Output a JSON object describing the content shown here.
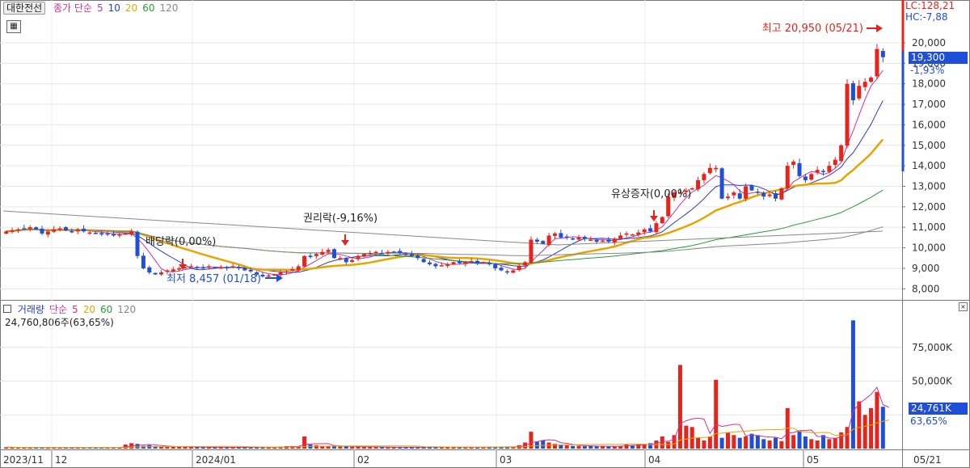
{
  "header": {
    "stock_name": "대한전선",
    "price_legend": [
      {
        "label": "종가 단순",
        "color": "#cc3399"
      },
      {
        "label": "5",
        "color": "#cc3399"
      },
      {
        "label": "10",
        "color": "#2a3fbf"
      },
      {
        "label": "20",
        "color": "#e6a500"
      },
      {
        "label": "60",
        "color": "#2a9a3a"
      },
      {
        "label": "120",
        "color": "#888888"
      }
    ],
    "volume_legend": [
      {
        "label": "거래량",
        "color": "#2a3fbf"
      },
      {
        "label": "단순",
        "color": "#cc3399"
      },
      {
        "label": "5",
        "color": "#cc3399"
      },
      {
        "label": "20",
        "color": "#e6a500"
      },
      {
        "label": "60",
        "color": "#2a9a3a"
      },
      {
        "label": "120",
        "color": "#888888"
      }
    ],
    "volume_value": "24,760,806주(63,65%)"
  },
  "right_panel": {
    "lc": "LC:128,21",
    "hc": "HC:-7,88",
    "price_tag": "19,300",
    "price_change": "-1,93%",
    "volume_tag": "24,761K",
    "volume_pct": "63,65%"
  },
  "colors": {
    "up": "#e8231b",
    "down": "#1f4fd8",
    "ma5": "#cc3399",
    "ma10": "#2a3fbf",
    "ma20": "#e6a500",
    "ma60": "#2a9a3a",
    "ma120": "#888888"
  },
  "chart_data": [
    {
      "type": "candlestick",
      "yticks": [
        8000,
        9000,
        10000,
        11000,
        12000,
        13000,
        14000,
        15000,
        16000,
        17000,
        18000,
        19000,
        20000
      ],
      "ytick_labels": [
        "8,000",
        "9,000",
        "10,000",
        "11,000",
        "12,000",
        "13,000",
        "14,000",
        "15,000",
        "16,000",
        "17,000",
        "18,000",
        "19,000",
        "20,000"
      ],
      "ylim": [
        7500,
        21300
      ],
      "x_labels": [
        "2023/11",
        "12",
        "2024/01",
        "02",
        "03",
        "04",
        "05",
        "05/21"
      ],
      "annotations": [
        {
          "text": "최고 20,950 (05/21)",
          "color": "#e8231b"
        },
        {
          "text": "최저 8,457 (01/18)",
          "color": "#1f4fd8"
        },
        {
          "text": "권리락(-9,16%)",
          "color": "#222222"
        },
        {
          "text": "배당락(0,00%)",
          "color": "#222222"
        },
        {
          "text": "유상증자(0,00%)",
          "color": "#222222"
        }
      ],
      "close": [
        10800,
        10850,
        10900,
        10950,
        11000,
        10900,
        10700,
        10800,
        10900,
        10950,
        10850,
        10800,
        10900,
        10800,
        10750,
        10700,
        10650,
        10700,
        10600,
        10650,
        10700,
        10800,
        9600,
        9000,
        8800,
        8700,
        8800,
        8900,
        8950,
        9000,
        9050,
        9100,
        9050,
        9000,
        9100,
        9050,
        9050,
        9000,
        9100,
        9000,
        8900,
        8850,
        8700,
        8600,
        8650,
        8700,
        8800,
        8850,
        8950,
        9100,
        9600,
        9550,
        9700,
        9800,
        9900,
        9500,
        9500,
        9300,
        9400,
        9600,
        9700,
        9750,
        9800,
        9750,
        9800,
        9800,
        9750,
        9700,
        9600,
        9500,
        9300,
        9200,
        9100,
        9150,
        9200,
        9300,
        9250,
        9300,
        9350,
        9250,
        9300,
        9200,
        9000,
        8900,
        8800,
        8900,
        9100,
        9300,
        10400,
        10300,
        10200,
        10600,
        10700,
        10500,
        10500,
        10400,
        10500,
        10450,
        10400,
        10300,
        10350,
        10300,
        10450,
        10600,
        10700,
        10650,
        10750,
        10900,
        10800,
        11200,
        11500,
        12500,
        12700,
        12700,
        12800,
        12900,
        13300,
        13600,
        13900,
        13900,
        12400,
        12500,
        12700,
        12400,
        13000,
        12800,
        12700,
        12500,
        12600,
        12400,
        12900,
        14000,
        14200,
        13500,
        13300,
        13600,
        13800,
        13700,
        14000,
        14300,
        15000,
        18000,
        17200,
        17900,
        18100,
        18300,
        19700,
        19300
      ],
      "volume_k": [
        1000,
        900,
        800,
        900,
        700,
        800,
        900,
        800,
        700,
        700,
        800,
        900,
        700,
        700,
        800,
        900,
        800,
        700,
        800,
        900,
        3000,
        4000,
        3500,
        2000,
        2500,
        1800,
        1500,
        1400,
        1300,
        1200,
        1200,
        1100,
        1100,
        1000,
        1000,
        1000,
        900,
        900,
        1000,
        900,
        1000,
        1100,
        1000,
        1200,
        1100,
        1000,
        1500,
        1800,
        1900,
        1700,
        9000,
        3000,
        2500,
        2000,
        1800,
        1700,
        1600,
        1500,
        1400,
        1300,
        1200,
        1200,
        1100,
        1100,
        1000,
        1000,
        1000,
        1100,
        1200,
        1100,
        1000,
        1200,
        1300,
        1100,
        1000,
        1100,
        1000,
        1000,
        1100,
        1200,
        1100,
        1200,
        1200,
        1300,
        1400,
        1200,
        2500,
        4500,
        12500,
        5000,
        6000,
        4500,
        3500,
        3000,
        2500,
        2000,
        2000,
        1800,
        1800,
        1700,
        1800,
        1600,
        1900,
        2000,
        3000,
        2500,
        3000,
        3500,
        4000,
        6000,
        9000,
        5000,
        10000,
        62000,
        17000,
        16000,
        8000,
        6000,
        9000,
        51000,
        8000,
        12000,
        10000,
        8000,
        9000,
        11000,
        10000,
        7000,
        6000,
        8000,
        5500,
        30000,
        10000,
        13000,
        9000,
        7000,
        6000,
        10000,
        7000,
        8000,
        12000,
        16000,
        95000,
        35000,
        25000,
        30000,
        42000,
        31000,
        24761
      ]
    }
  ]
}
